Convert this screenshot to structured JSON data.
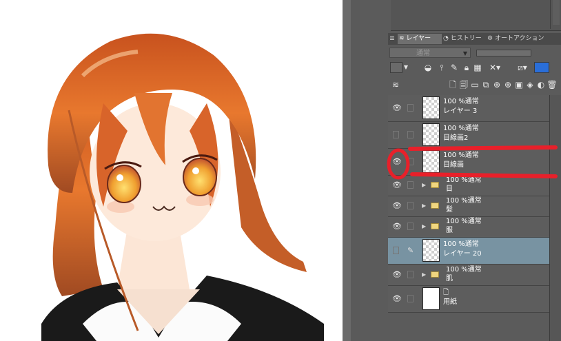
{
  "canvas": {
    "description_free": true
  },
  "tabs": [
    {
      "label": "レイヤー",
      "active": true
    },
    {
      "label": "ヒストリー",
      "active": false
    },
    {
      "label": "オートアクション",
      "active": false
    }
  ],
  "blend_mode": {
    "value": "通常"
  },
  "layers": [
    {
      "visible": true,
      "mode": "100 %通常",
      "name": "レイヤー 3",
      "kind": "raster",
      "selected": false
    },
    {
      "visible": false,
      "mode": "100 %通常",
      "name": "目線画2",
      "kind": "raster",
      "selected": false
    },
    {
      "visible": true,
      "mode": "100 %通常",
      "name": "目線画",
      "kind": "raster",
      "selected": false
    },
    {
      "visible": true,
      "mode": "100 %通常",
      "name": "目",
      "kind": "folder",
      "selected": false
    },
    {
      "visible": true,
      "mode": "100 %通常",
      "name": "髪",
      "kind": "folder",
      "selected": false
    },
    {
      "visible": true,
      "mode": "100 %通常",
      "name": "服",
      "kind": "folder",
      "selected": false
    },
    {
      "visible": false,
      "mode": "100 %通常",
      "name": "レイヤー 20",
      "kind": "raster",
      "selected": true
    },
    {
      "visible": true,
      "mode": "100 %通常",
      "name": "肌",
      "kind": "folder",
      "selected": false
    },
    {
      "visible": true,
      "mode": "",
      "name": "用紙",
      "kind": "paper",
      "selected": false
    }
  ],
  "colors": {
    "selection": "#7893a2",
    "annotation": "#e8202a",
    "panel": "#5b5b5b"
  }
}
